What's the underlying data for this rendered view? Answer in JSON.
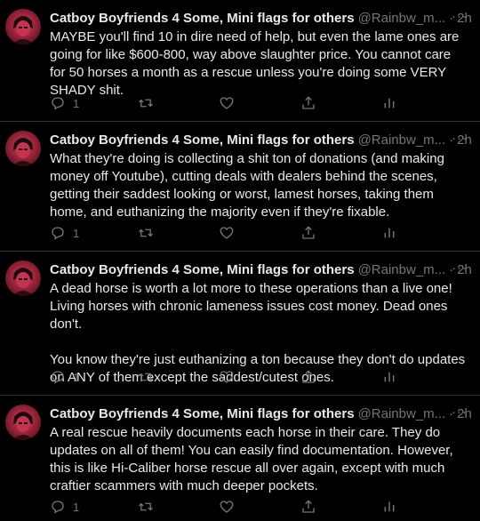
{
  "tweets": [
    {
      "name": "Catboy Boyfriends 4 Some, Mini flags for others",
      "handle": "@Rainbw_m...",
      "separator": "·",
      "time": "2h",
      "more": "···",
      "text": "MAYBE you'll find 10 in dire need of help, but even the lame ones are going for like $600-800, way above slaughter price. You cannot care for 50 horses a month as a rescue unless you're doing some VERY SHADY shit.",
      "reply_count": "1"
    },
    {
      "name": "Catboy Boyfriends 4 Some, Mini flags for others",
      "handle": "@Rainbw_m...",
      "separator": "·",
      "time": "2h",
      "more": "···",
      "text": "What they're doing is collecting a shit ton of donations (and making money off Youtube), cutting deals with dealers behind the scenes, getting their saddest looking or worst, lamest horses, taking them home, and euthanizing the majority even if they're fixable.",
      "reply_count": "1"
    },
    {
      "name": "Catboy Boyfriends 4 Some, Mini flags for others",
      "handle": "@Rainbw_m...",
      "separator": "·",
      "time": "2h",
      "more": "···",
      "text": "A dead horse is worth a lot more to these operations than a live one! Living horses with chronic lameness issues cost money. Dead ones don't.\n\nYou know they're just euthanizing a ton because they don't do updates on ANY of them except the saddest/cutest ones.",
      "reply_count": "1"
    },
    {
      "name": "Catboy Boyfriends 4 Some, Mini flags for others",
      "handle": "@Rainbw_m...",
      "separator": "·",
      "time": "2h",
      "more": "···",
      "text": "A real rescue heavily documents each horse in their care. They do updates on all of them! You can easily find documentation. However, this is like Hi-Caliber horse rescue all over again, except with much craftier scammers with much deeper pockets.",
      "reply_count": "1"
    }
  ],
  "icons": {
    "reply": "reply-icon",
    "retweet": "retweet-icon",
    "like": "heart-icon",
    "share": "share-icon",
    "stats": "analytics-icon"
  },
  "colors": {
    "background": "#000000",
    "text": "#e7e9ea",
    "secondary": "#71767b",
    "divider": "#2f3336",
    "avatar_accent": "#d23d56"
  }
}
